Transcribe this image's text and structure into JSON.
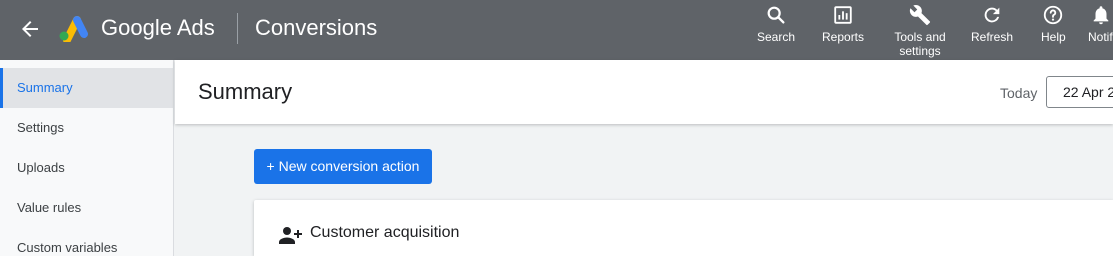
{
  "header": {
    "brand_google": "Google",
    "brand_ads": "Ads",
    "page_title": "Conversions",
    "tools": [
      {
        "label": "Search",
        "icon": "search-icon"
      },
      {
        "label": "Reports",
        "icon": "reports-icon"
      },
      {
        "label": "Tools and settings",
        "icon": "wrench-icon"
      },
      {
        "label": "Refresh",
        "icon": "refresh-icon"
      },
      {
        "label": "Help",
        "icon": "help-icon"
      },
      {
        "label": "Notifications",
        "icon": "bell-icon"
      }
    ]
  },
  "sidebar": {
    "items": [
      {
        "label": "Summary",
        "active": true
      },
      {
        "label": "Settings"
      },
      {
        "label": "Uploads"
      },
      {
        "label": "Value rules"
      },
      {
        "label": "Custom variables"
      }
    ]
  },
  "main": {
    "title": "Summary",
    "date_label": "Today",
    "date_value": "22 Apr 2",
    "new_button": "+ New conversion action",
    "card_title": "Customer acquisition"
  },
  "colors": {
    "header_bg": "#5f6368",
    "accent": "#1a73e8"
  }
}
